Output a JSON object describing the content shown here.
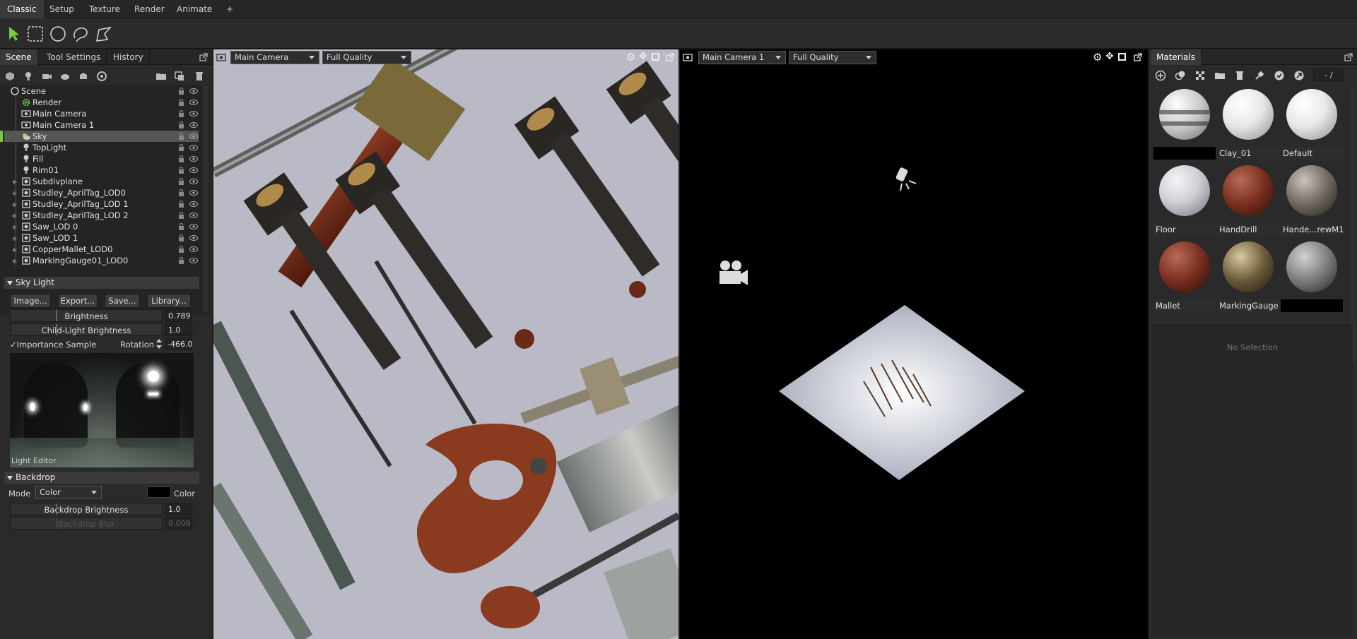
{
  "menubar": {
    "tabs": [
      "Classic",
      "Setup",
      "Texture",
      "Render",
      "Animate",
      "+"
    ]
  },
  "toolbar": {
    "tools": [
      "select-arrow-icon",
      "rect-select-icon",
      "circle-select-icon",
      "lasso-select-icon",
      "polygon-select-icon"
    ]
  },
  "left_panel": {
    "tabs": [
      "Scene",
      "Tool Settings",
      "History"
    ],
    "scene_tree": [
      {
        "label": "Scene",
        "icon": "scene-icon",
        "depth": 0
      },
      {
        "label": "Render",
        "icon": "gear-icon",
        "depth": 1
      },
      {
        "label": "Main Camera",
        "icon": "camera-icon",
        "depth": 1
      },
      {
        "label": "Main Camera 1",
        "icon": "camera-icon",
        "depth": 1
      },
      {
        "label": "Sky",
        "icon": "sky-icon",
        "depth": 1,
        "selected": true
      },
      {
        "label": "TopLight",
        "icon": "light-icon",
        "depth": 1
      },
      {
        "label": "Fill",
        "icon": "light-icon",
        "depth": 1
      },
      {
        "label": "Rim01",
        "icon": "light-icon",
        "depth": 1
      },
      {
        "label": "Subdivplane",
        "icon": "mesh-icon",
        "depth": 1
      },
      {
        "label": "Studley_AprilTag_LOD0",
        "icon": "mesh-icon",
        "depth": 1
      },
      {
        "label": "Studley_AprilTag_LOD 1",
        "icon": "mesh-icon",
        "depth": 1
      },
      {
        "label": "Studley_AprilTag_LOD 2",
        "icon": "mesh-icon",
        "depth": 1
      },
      {
        "label": "Saw_LOD 0",
        "icon": "mesh-icon",
        "depth": 1
      },
      {
        "label": "Saw_LOD 1",
        "icon": "mesh-icon",
        "depth": 1
      },
      {
        "label": "CopperMallet_LOD0",
        "icon": "mesh-icon",
        "depth": 1
      },
      {
        "label": "MarkingGauge01_LOD0",
        "icon": "mesh-icon",
        "depth": 1
      }
    ],
    "sky_light": {
      "title": "Sky Light",
      "buttons": [
        "Image...",
        "Export...",
        "Save...",
        "Library..."
      ],
      "brightness_label": "Brightness",
      "brightness_value": "0.789",
      "child_label": "Child-Light Brightness",
      "child_value": "1.0",
      "importance_label": "Importance Sample",
      "rotation_label": "Rotation",
      "rotation_value": "-466.0",
      "light_editor_label": "Light Editor"
    },
    "backdrop": {
      "title": "Backdrop",
      "mode_label": "Mode",
      "mode_value": "Color",
      "color_label": "Color",
      "brightness_label": "Backdrop Brightness",
      "brightness_value": "1.0",
      "blur_label": "Backdrop Blur",
      "blur_value": "0.009"
    }
  },
  "viewport_left": {
    "camera": "Main Camera",
    "quality": "Full Quality"
  },
  "viewport_right": {
    "camera": "Main Camera 1",
    "quality": "Full Quality"
  },
  "materials": {
    "title": "Materials",
    "counter": "- /",
    "items": [
      {
        "name": "",
        "style": "striped"
      },
      {
        "name": "Clay_01",
        "style": "white"
      },
      {
        "name": "Default",
        "style": "white"
      },
      {
        "name": "Floor",
        "style": "grey"
      },
      {
        "name": "HandDrill",
        "style": "red"
      },
      {
        "name": "Hande...rewM1",
        "style": "metal"
      },
      {
        "name": "Mallet",
        "style": "red"
      },
      {
        "name": "MarkingGauge",
        "style": "brass"
      },
      {
        "name": "",
        "style": "steel"
      }
    ],
    "no_selection": "No Selection"
  },
  "colors": {
    "accent": "#7ac943",
    "panel": "#2a2a2a",
    "viewport_bg": "#000000"
  }
}
